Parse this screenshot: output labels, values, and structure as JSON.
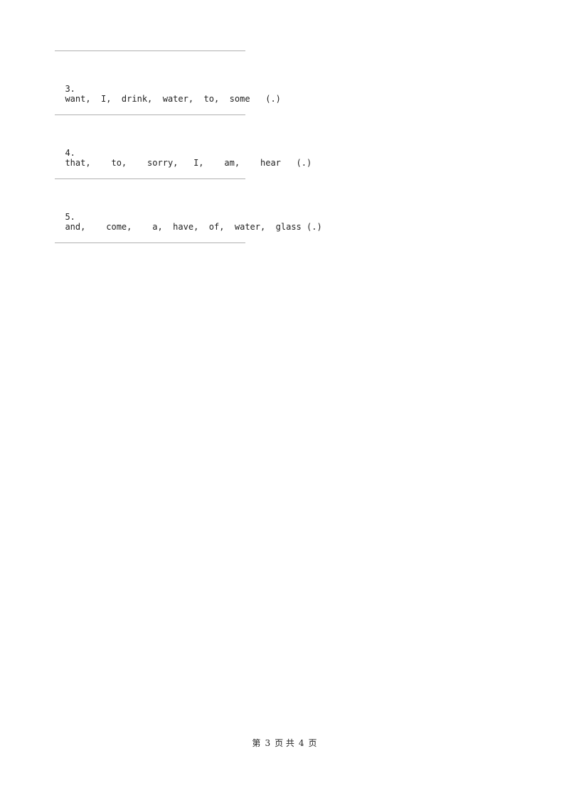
{
  "questions": [
    {
      "number": "3.",
      "text": "want,  I,  drink,  water,  to,  some   (.)"
    },
    {
      "number": "4.",
      "text": "that,    to,    sorry,   I,    am,    hear   (.)"
    },
    {
      "number": "5.",
      "text": "and,    come,    a,  have,  of,  water,  glass (.)"
    }
  ],
  "footer": {
    "prefix": "第",
    "page": "3",
    "mid": "页 共",
    "total": "4",
    "suffix": "页"
  }
}
